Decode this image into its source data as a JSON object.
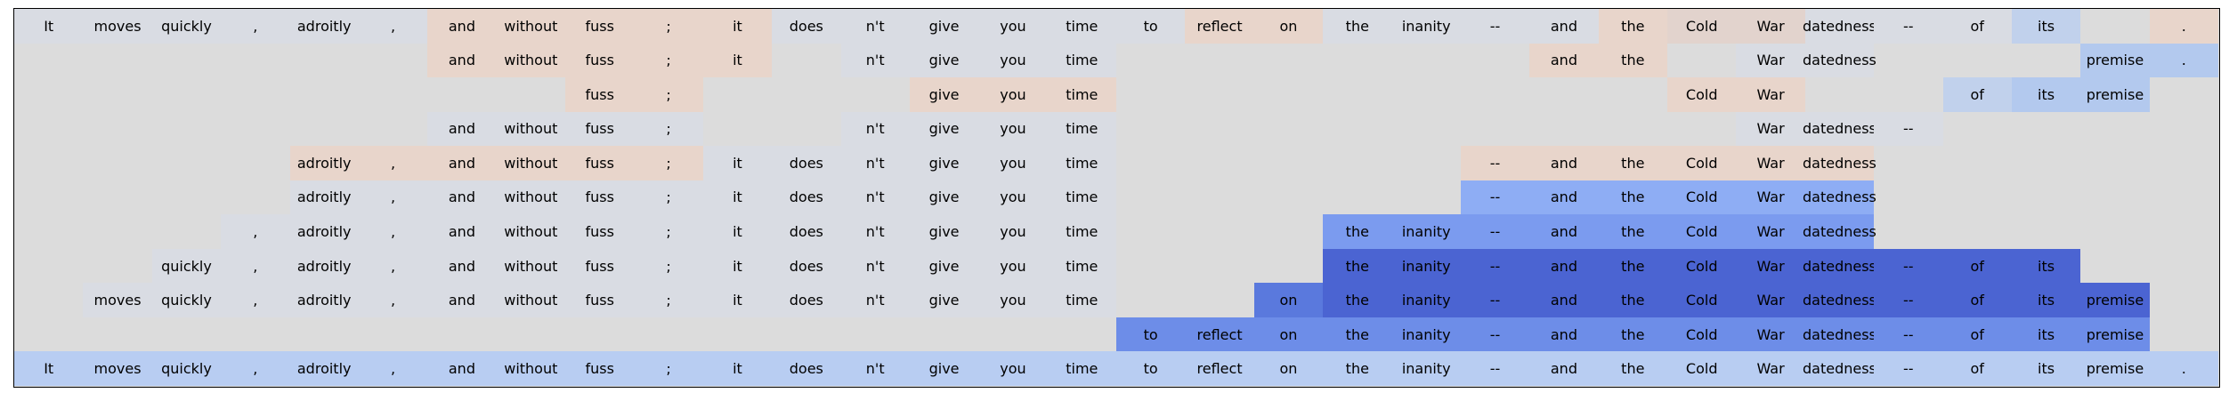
{
  "tokens": [
    "It",
    "moves",
    "quickly",
    ",",
    "adroitly",
    ",",
    "and",
    "without",
    "fuss",
    ";",
    "it",
    "does",
    "n't",
    "give",
    "you",
    "time",
    "to",
    "reflect",
    "on",
    "the",
    "inanity",
    "--",
    "and",
    "the",
    "Cold",
    "War",
    "datedness",
    "--",
    "of",
    "its",
    "premise",
    "."
  ],
  "colors": {
    "background": "#dcdcdc",
    "A": "#d9dce3",
    "B": "#e8d5cb",
    "C": "#e2d3cd",
    "D": "#cdd6e6",
    "E": "#c1d1ec",
    "F": "#b3c9ee",
    "G": "#8eadf4",
    "H": "#7b9bef",
    "I": "#5a79dd",
    "J": "#4b64d2",
    "K": "#6d8de8",
    "L": "#b8cdf2"
  },
  "rows": [
    "AAAAAABBBBBAAAAAABBAAAABCCAAAE.B",
    "......BBBBB.AAAA......BB.AA...FF",
    "........BB...BBB........BB..EFF.",
    "......AAAA..AAAA.........AAA....",
    "....BBBBBBAAAAAA.....BBBBBB.....",
    "....AAAAAAAAAAAA.....GGGGGG.....",
    "...AAAAAAAAAAAAA...HHHHHHHH.....",
    "..AAAAAAAAAAAAAA...JJJJJJJJJJJ..",
    ".AAAAAAAAAAAAAAA..IJJJJJJJJJJJJ.",
    "................KKKKKKKKKKKKKKK.",
    "LLLLLLLLLLLLLLLLLLLLLLLLLLLLLLLL"
  ]
}
